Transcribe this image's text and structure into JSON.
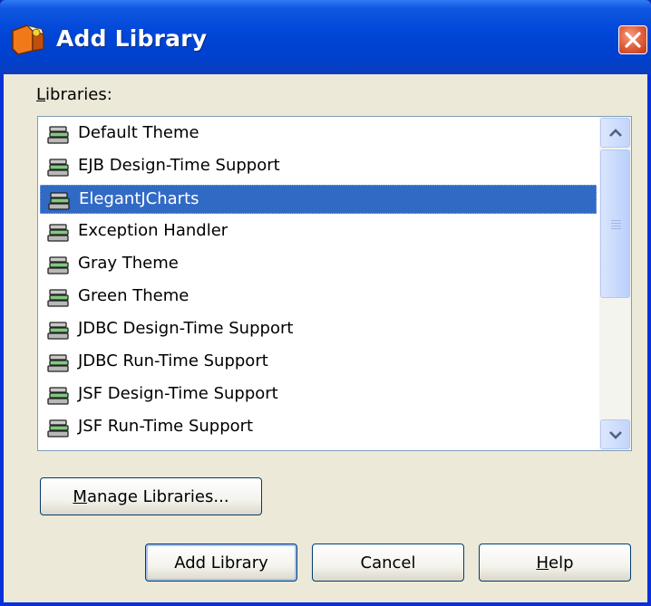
{
  "window": {
    "title": "Add Library",
    "app_icon": "netbeans-library-icon",
    "close_icon": "close-icon"
  },
  "libraries": {
    "label_mnemonic": "L",
    "label_rest": "ibraries:",
    "item_icon": "library-jar-icon",
    "items": [
      {
        "label": "Default Theme",
        "selected": false
      },
      {
        "label": "EJB Design-Time Support",
        "selected": false
      },
      {
        "label": "ElegantJCharts",
        "selected": true
      },
      {
        "label": "Exception Handler",
        "selected": false
      },
      {
        "label": "Gray Theme",
        "selected": false
      },
      {
        "label": "Green Theme",
        "selected": false
      },
      {
        "label": "JDBC Design-Time Support",
        "selected": false
      },
      {
        "label": "JDBC Run-Time Support",
        "selected": false
      },
      {
        "label": "JSF Design-Time Support",
        "selected": false
      },
      {
        "label": "JSF Run-Time Support",
        "selected": false
      }
    ]
  },
  "buttons": {
    "manage_mnemonic": "M",
    "manage_rest": "anage Libraries...",
    "add_library": "Add Library",
    "cancel": "Cancel",
    "help_mnemonic": "H",
    "help_rest": "elp"
  },
  "colors": {
    "selection": "#316ac5",
    "title_bar": "#0046d8",
    "dialog_face": "#ece9d8"
  }
}
